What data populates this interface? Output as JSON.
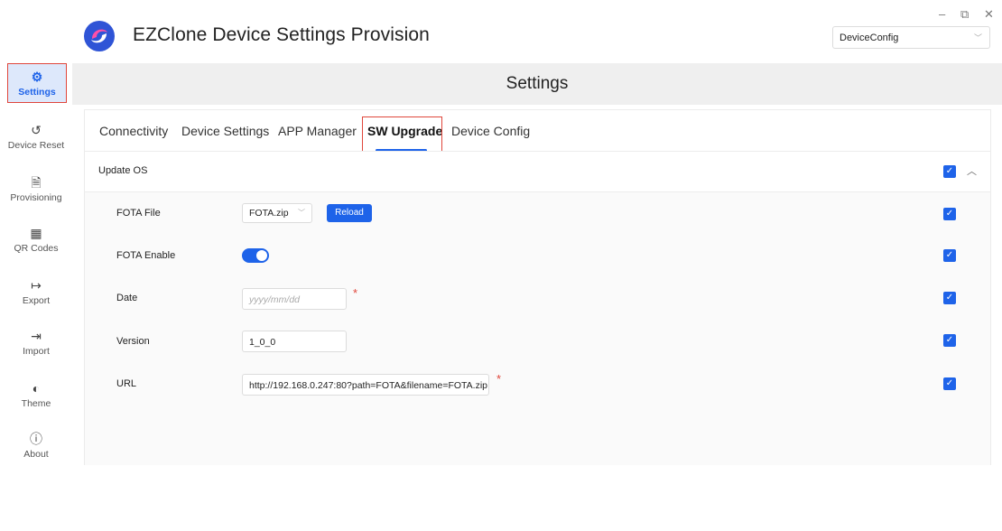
{
  "app": {
    "title": "EZClone Device Settings Provision",
    "profile_select": "DeviceConfig",
    "window_controls": {
      "minimize": "–",
      "restore": "⧉",
      "close": "✕"
    }
  },
  "sidebar": {
    "items": [
      {
        "label": "Settings",
        "icon": "gear-icon",
        "glyph": "⚙"
      },
      {
        "label": "Device Reset",
        "icon": "reset-icon",
        "glyph": "↺"
      },
      {
        "label": "Provisioning",
        "icon": "file-lock-icon",
        "glyph": "🗎"
      },
      {
        "label": "QR Codes",
        "icon": "qr-code-icon",
        "glyph": "▦"
      },
      {
        "label": "Export",
        "icon": "export-icon",
        "glyph": "↦"
      },
      {
        "label": "Import",
        "icon": "import-icon",
        "glyph": "⇥"
      },
      {
        "label": "Theme",
        "icon": "theme-icon",
        "glyph": "◐"
      },
      {
        "label": "About",
        "icon": "info-icon",
        "glyph": "ⓘ"
      }
    ],
    "active": "Settings"
  },
  "main": {
    "header": "Settings",
    "tabs": [
      "Connectivity",
      "Device Settings",
      "APP Manager",
      "SW Upgrade",
      "Device Config"
    ],
    "active_tab": "SW Upgrade",
    "section": {
      "title": "Update OS",
      "fields": {
        "fota_file": {
          "label": "FOTA File",
          "value": "FOTA.zip",
          "button": "Reload",
          "checked": true
        },
        "fota_enable": {
          "label": "FOTA Enable",
          "value": true,
          "checked": true
        },
        "date": {
          "label": "Date",
          "placeholder": "yyyy/mm/dd",
          "required": "*",
          "checked": true
        },
        "version": {
          "label": "Version",
          "value": "1_0_0",
          "checked": true
        },
        "url": {
          "label": "URL",
          "value": "http://192.168.0.247:80?path=FOTA&filename=FOTA.zip",
          "required": "*",
          "checked": true
        }
      }
    }
  },
  "colors": {
    "accent": "#1e63e9",
    "highlight_border": "#e0463b",
    "active_bg": "#dde8fb"
  }
}
